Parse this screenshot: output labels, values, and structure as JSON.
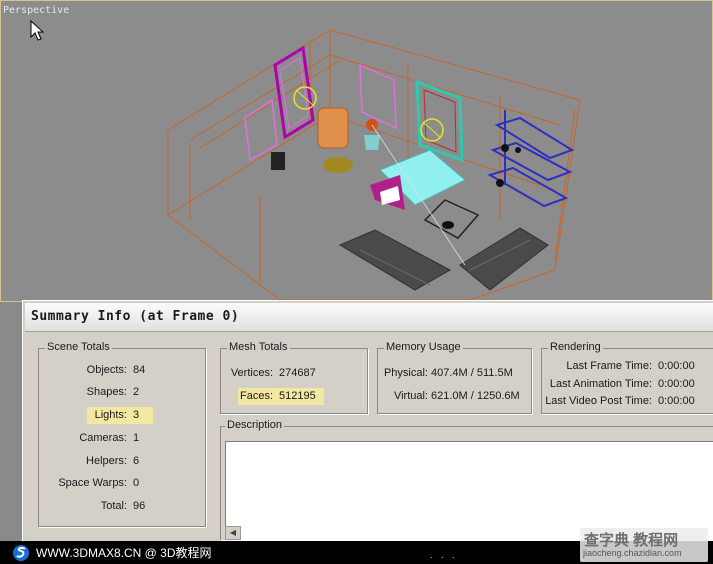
{
  "viewport": {
    "label": "Perspective"
  },
  "dialog": {
    "title": "Summary Info (at Frame 0)",
    "scene_totals": {
      "legend": "Scene Totals",
      "rows": [
        {
          "label": "Objects:",
          "value": "84"
        },
        {
          "label": "Shapes:",
          "value": "2"
        },
        {
          "label": "Lights:",
          "value": "3"
        },
        {
          "label": "Cameras:",
          "value": "1"
        },
        {
          "label": "Helpers:",
          "value": "6"
        },
        {
          "label": "Space Warps:",
          "value": "0"
        },
        {
          "label": "Total:",
          "value": "96"
        }
      ]
    },
    "mesh_totals": {
      "legend": "Mesh Totals",
      "rows": [
        {
          "label": "Vertices:",
          "value": "274687"
        },
        {
          "label": "Faces:",
          "value": "512195"
        }
      ]
    },
    "memory_usage": {
      "legend": "Memory Usage",
      "rows": [
        {
          "label": "Physical:",
          "value": "407.4M / 511.5M"
        },
        {
          "label": "Virtual:",
          "value": "621.0M / 1250.6M"
        }
      ]
    },
    "rendering": {
      "legend": "Rendering",
      "rows": [
        {
          "label": "Last Frame Time:",
          "value": "0:00:00"
        },
        {
          "label": "Last Animation Time:",
          "value": "0:00:00"
        },
        {
          "label": "Last Video Post Time:",
          "value": "0:00:00"
        }
      ]
    },
    "description": {
      "legend": "Description"
    }
  },
  "footer": {
    "site_text": "WWW.3DMAX8.CN @ 3D教程网",
    "dots": ". . ."
  },
  "watermark": {
    "name": "查字典 教程网",
    "url": "jiaocheng.chazidian.com"
  },
  "colors": {
    "highlight": "#f2e8a0",
    "wireframe": "#d2691e",
    "viewport_bg": "#8c8c8c"
  }
}
